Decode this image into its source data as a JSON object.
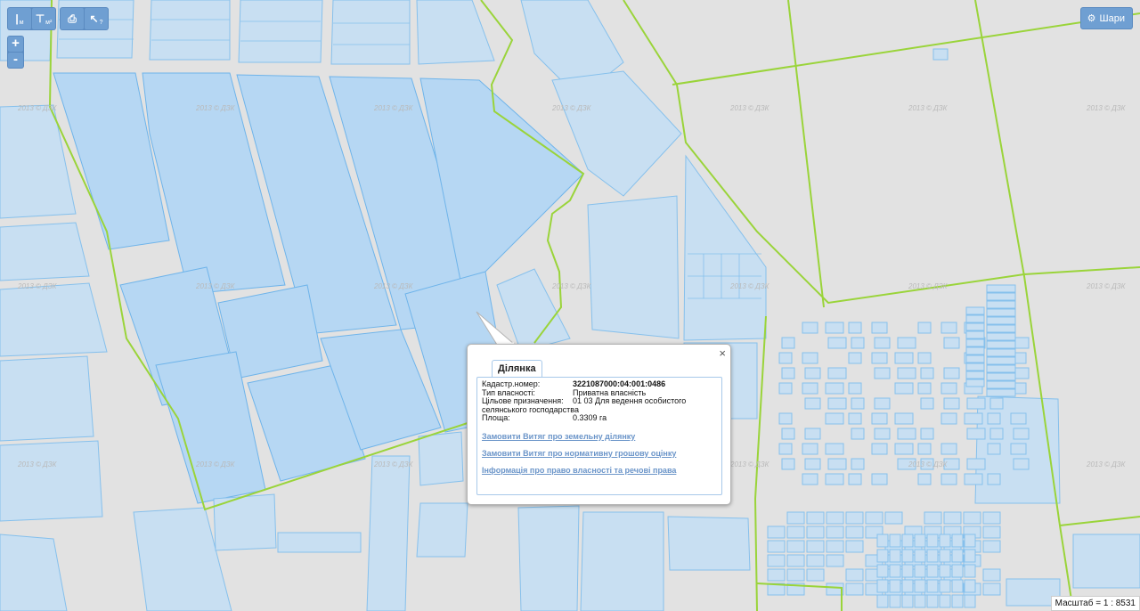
{
  "toolbar": {
    "tools": [
      {
        "name": "measure-length-button",
        "glyph": "|",
        "sub": "м"
      },
      {
        "name": "measure-area-button",
        "glyph": "⊤",
        "sub": "м²"
      },
      {
        "name": "print-button",
        "glyph": "⎙",
        "sub": ""
      },
      {
        "name": "info-cursor-button",
        "glyph": "↖",
        "sub": "?"
      }
    ]
  },
  "zoom": {
    "in_label": "+",
    "out_label": "-"
  },
  "layers": {
    "label": "Шари",
    "icon": "gear-icon"
  },
  "map": {
    "watermark": "2013 © ДЗК",
    "colors": {
      "parcel": "#c8dff2",
      "parcel_border": "#86c0ec",
      "boundary": "#9ad43a",
      "background": "#e2e2e2"
    }
  },
  "popup": {
    "tab_label": "Ділянка",
    "close_label": "×",
    "fields": {
      "cadastral_label": "Кадастр.номер:",
      "cadastral_value": "3221087000:04:001:0486",
      "ownership_label": "Тип власності:",
      "ownership_value": "Приватна власність",
      "purpose_label": "Цільове призначення:",
      "purpose_value": "01 03 Для ведення особистого",
      "purpose_value_cont": "селянського господарства",
      "area_label": "Площа:",
      "area_value": "0.3309 га"
    },
    "links": [
      "Замовити Витяг про земельну ділянку",
      "Замовити Витяг про нормативну грошову оцінку",
      "Інформація про право власності та речові права"
    ]
  },
  "scale": {
    "label": "Масштаб = 1 : 8531"
  }
}
